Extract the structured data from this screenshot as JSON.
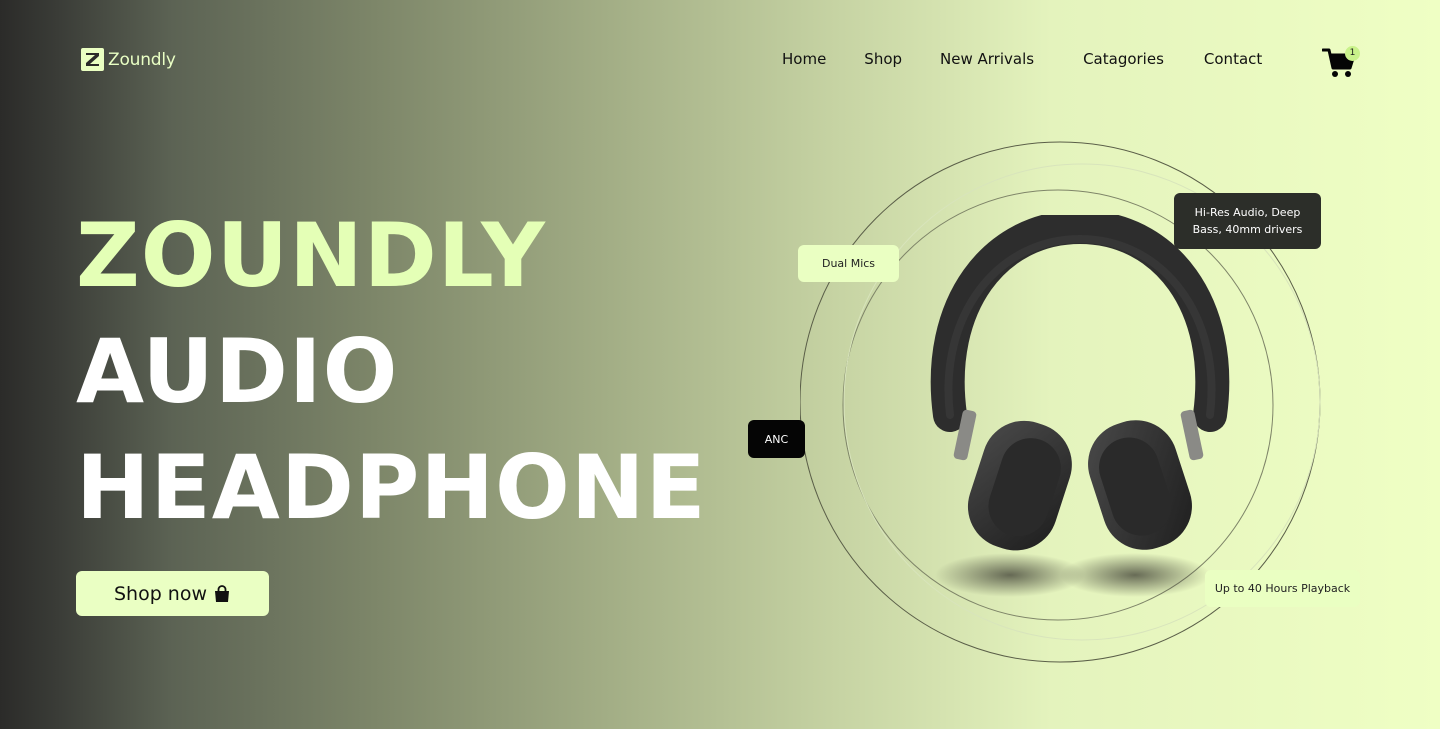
{
  "brand": {
    "name": "Zoundly",
    "logo_letter": "Z",
    "accent": "#eaffc2"
  },
  "nav": {
    "items": [
      {
        "label": "Home"
      },
      {
        "label": "Shop"
      },
      {
        "label": "New Arrivals"
      },
      {
        "label": "Catagories"
      },
      {
        "label": "Contact"
      }
    ]
  },
  "cart": {
    "icon": "cart-icon",
    "count": "1"
  },
  "hero": {
    "line1": "ZOUNDLY",
    "line2": "AUDIO",
    "line3": "HEADPHONE",
    "cta_label": "Shop now",
    "cta_icon": "shopping-bag-icon"
  },
  "features": {
    "mics": "Dual Mics",
    "anc": "ANC",
    "hires_line1": "Hi-Res Audio, Deep",
    "hires_line2": "Bass, 40mm drivers",
    "playback": "Up to 40 Hours Playback"
  }
}
